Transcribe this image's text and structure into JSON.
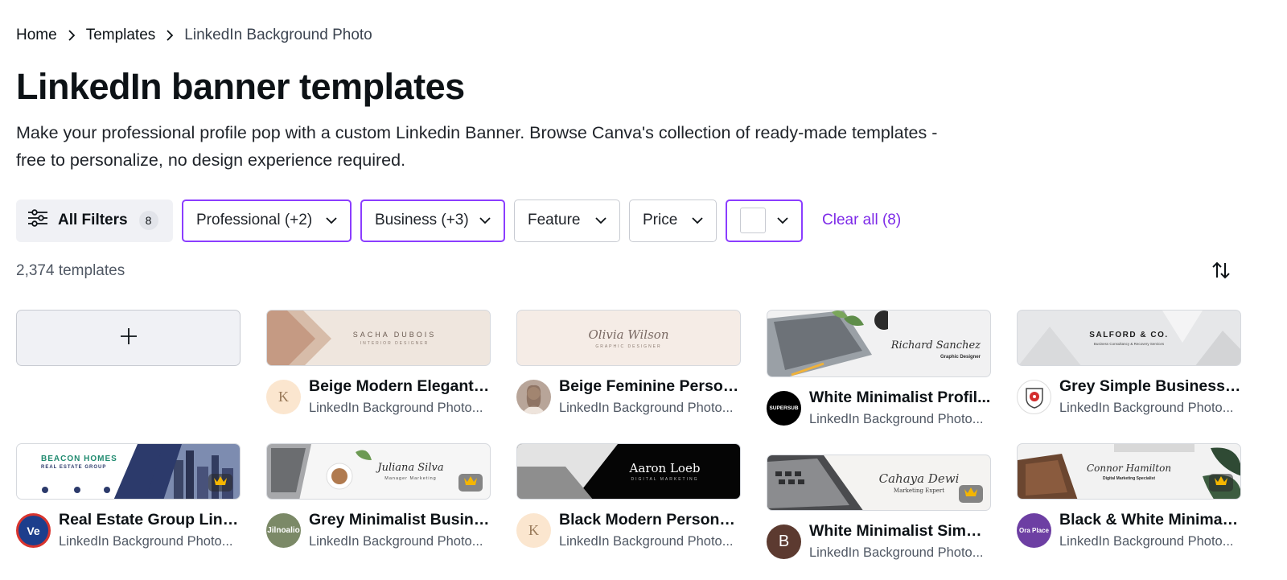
{
  "breadcrumb": {
    "home": "Home",
    "templates": "Templates",
    "current": "LinkedIn Background Photo"
  },
  "page": {
    "title": "LinkedIn banner templates",
    "description": "Make your professional profile pop with a custom Linkedin Banner. Browse Canva's collection of ready-made templates - free to personalize, no design experience required."
  },
  "filters": {
    "all_filters_label": "All Filters",
    "all_filters_count": "8",
    "professional": "Professional (+2)",
    "business": "Business (+3)",
    "feature": "Feature",
    "price": "Price",
    "clear_all": "Clear all (8)"
  },
  "results": {
    "count_label": "2,374 templates"
  },
  "colors": {
    "accent": "#8b3dff",
    "link": "#7d2ae8"
  },
  "cards": [
    {
      "title": "Beige Modern Elegant ...",
      "subtitle": "LinkedIn Background Photo...",
      "thumb_title": "SACHA DUBOIS",
      "thumb_sub": "INTERIOR DESIGNER",
      "avatar_text": "K"
    },
    {
      "title": "Beige Feminine Person...",
      "subtitle": "LinkedIn Background Photo...",
      "thumb_title": "Olivia Wilson",
      "thumb_sub": "GRAPHIC DESIGNER"
    },
    {
      "title": "White Minimalist Profil...",
      "subtitle": "LinkedIn Background Photo...",
      "thumb_title": "Richard Sanchez",
      "thumb_sub": "Graphic Designer",
      "avatar_text": "SUPERSUB"
    },
    {
      "title": "Grey Simple Business C...",
      "subtitle": "LinkedIn Background Photo...",
      "thumb_title": "SALFORD & CO.",
      "thumb_sub": "Business Consultancy & Recovery Services"
    },
    {
      "title": "Real Estate Group Link...",
      "subtitle": "LinkedIn Background Photo...",
      "thumb_title": "BEACON HOMES",
      "thumb_sub": "REAL ESTATE GROUP",
      "avatar_text": "Ve"
    },
    {
      "title": "Grey Minimalist Busine...",
      "subtitle": "LinkedIn Background Photo...",
      "thumb_title": "Juliana Silva",
      "thumb_sub": "Manager Marketing",
      "avatar_text": "Jilnoalio"
    },
    {
      "title": "Black Modern Personal...",
      "subtitle": "LinkedIn Background Photo...",
      "thumb_title": "Aaron Loeb",
      "thumb_sub": "DIGITAL MARKETING",
      "avatar_text": "K"
    },
    {
      "title": "White Minimalist Simpl...",
      "subtitle": "LinkedIn Background Photo...",
      "thumb_title": "Cahaya Dewi",
      "thumb_sub": "Marketing Expert",
      "avatar_text": "B"
    },
    {
      "title": "Black & White Minimali...",
      "subtitle": "LinkedIn Background Photo...",
      "thumb_title": "Connor Hamilton",
      "thumb_sub": "Digital Marketing Specialist",
      "avatar_text": "Ora Place"
    }
  ]
}
